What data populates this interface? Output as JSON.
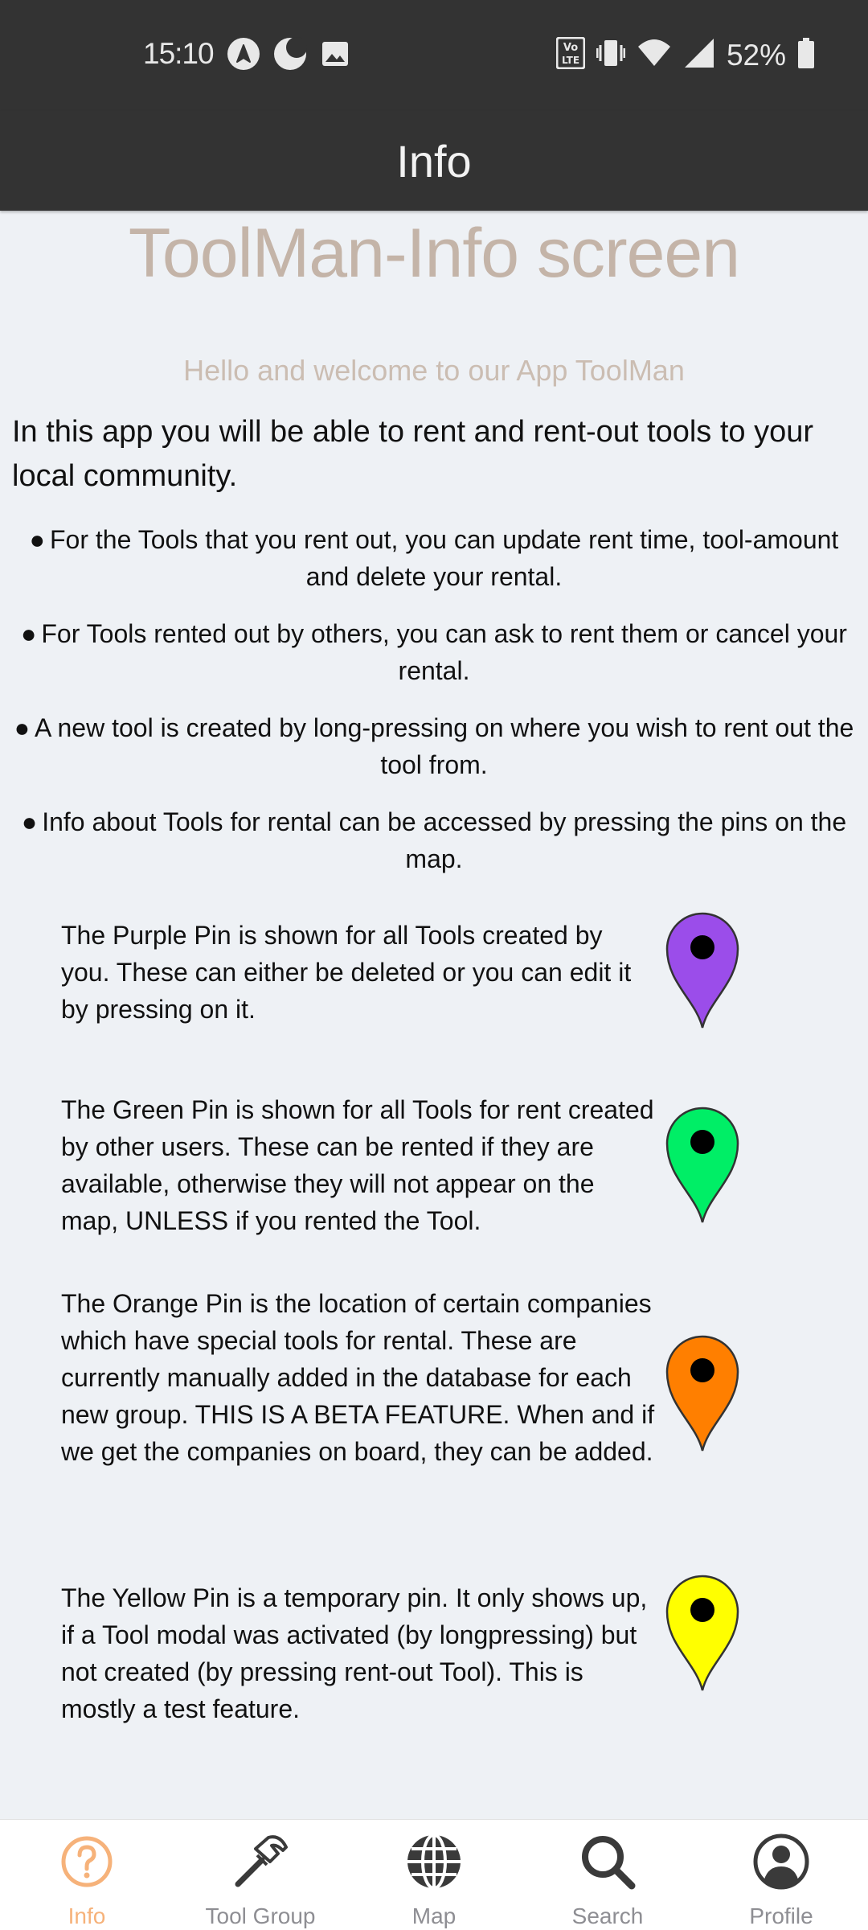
{
  "status_bar": {
    "time": "15:10",
    "battery": "52%",
    "left_icons": [
      "navigation-arrow-icon",
      "moon-icon",
      "image-icon"
    ],
    "right_icons": [
      "volte-icon",
      "vibrate-icon",
      "wifi-icon",
      "signal-icon",
      "battery-icon"
    ]
  },
  "header": {
    "title": "Info"
  },
  "content": {
    "title": "ToolMan-Info screen",
    "welcome": "Hello and welcome to our App ToolMan",
    "intro": "In this app you will be able to rent and rent-out tools to your local community.",
    "bullets": [
      "For the Tools that you rent out, you can update rent time, tool-amount and delete your rental.",
      "For Tools rented out by others, you can ask to rent them or cancel your rental.",
      "A new tool is created by long-pressing on where you wish to rent out the tool from.",
      "Info about Tools for rental can be accessed by pressing the pins on the map."
    ],
    "bullet_dot": "●",
    "pins": [
      {
        "color": "#9b4dea",
        "text": "The Purple Pin is shown for all Tools created by you. These can either be deleted or you can edit it by pressing on it."
      },
      {
        "color": "#00ee66",
        "text": "The Green Pin is shown for all Tools for rent created by other users. These can be rented if they are available, otherwise they will not appear on the map, UNLESS if you rented the Tool."
      },
      {
        "color": "#ff7f00",
        "text": "The Orange Pin is the location of certain companies which have special tools for rental. These are currently manually added in the database for each new group. THIS IS A BETA FEATURE. When and if we get the companies on board, they can be added."
      },
      {
        "color": "#ffff00",
        "text": "The Yellow Pin is a temporary pin. It only shows up, if a Tool modal was activated (by longpressing) but not created (by pressing rent-out Tool). This is mostly a test feature."
      }
    ]
  },
  "bottom_nav": {
    "active_color": "#f6b27a",
    "items": [
      {
        "label": "Info",
        "icon": "question-circle-icon",
        "active": true
      },
      {
        "label": "Tool Group",
        "icon": "hammer-icon",
        "active": false
      },
      {
        "label": "Map",
        "icon": "globe-icon",
        "active": false
      },
      {
        "label": "Search",
        "icon": "search-icon",
        "active": false
      },
      {
        "label": "Profile",
        "icon": "user-circle-icon",
        "active": false
      }
    ]
  }
}
